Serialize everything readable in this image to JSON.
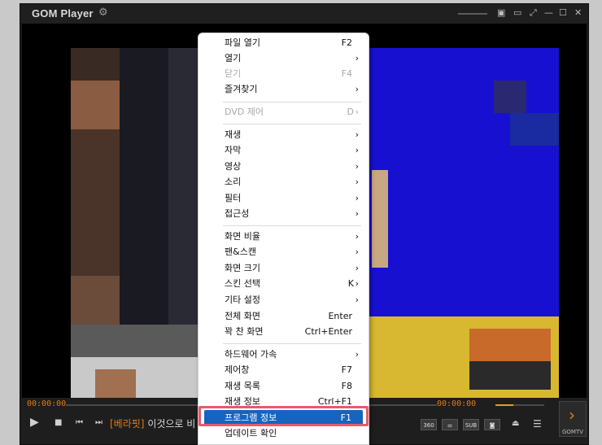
{
  "app": {
    "title": "GOM Player"
  },
  "player": {
    "time_elapsed": "00:00:00",
    "time_total": "00:00:00",
    "ticker_tag": "[베라핏]",
    "ticker_text": "이것으로 비",
    "buttons": {
      "sub": "SUB",
      "gomtv": "GOMTV"
    }
  },
  "menu": {
    "items": [
      {
        "label": "파일 열기",
        "shortcut": "F2",
        "arrow": "",
        "disabled": false
      },
      {
        "label": "열기",
        "shortcut": "",
        "arrow": "›",
        "disabled": false
      },
      {
        "label": "닫기",
        "shortcut": "F4",
        "arrow": "",
        "disabled": true
      },
      {
        "label": "즐겨찾기",
        "shortcut": "",
        "arrow": "›",
        "disabled": false
      },
      {
        "label": "DVD 제어",
        "shortcut": "D",
        "arrow": "›",
        "disabled": true
      },
      {
        "label": "재생",
        "shortcut": "",
        "arrow": "›",
        "disabled": false
      },
      {
        "label": "자막",
        "shortcut": "",
        "arrow": "›",
        "disabled": false
      },
      {
        "label": "영상",
        "shortcut": "",
        "arrow": "›",
        "disabled": false
      },
      {
        "label": "소리",
        "shortcut": "",
        "arrow": "›",
        "disabled": false
      },
      {
        "label": "필터",
        "shortcut": "",
        "arrow": "›",
        "disabled": false
      },
      {
        "label": "접근성",
        "shortcut": "",
        "arrow": "›",
        "disabled": false
      },
      {
        "label": "화면 비율",
        "shortcut": "",
        "arrow": "›",
        "disabled": false
      },
      {
        "label": "팬&스캔",
        "shortcut": "",
        "arrow": "›",
        "disabled": false
      },
      {
        "label": "화면 크기",
        "shortcut": "",
        "arrow": "›",
        "disabled": false
      },
      {
        "label": "스킨 선택",
        "shortcut": "K",
        "arrow": "›",
        "disabled": false
      },
      {
        "label": "기타 설정",
        "shortcut": "",
        "arrow": "›",
        "disabled": false
      },
      {
        "label": "전체 화면",
        "shortcut": "Enter",
        "arrow": "",
        "disabled": false
      },
      {
        "label": "꽉 찬 화면",
        "shortcut": "Ctrl+Enter",
        "arrow": "",
        "disabled": false
      },
      {
        "label": "하드웨어 가속",
        "shortcut": "",
        "arrow": "›",
        "disabled": false
      },
      {
        "label": "제어창",
        "shortcut": "F7",
        "arrow": "",
        "disabled": false
      },
      {
        "label": "재생 목록",
        "shortcut": "F8",
        "arrow": "",
        "disabled": false
      },
      {
        "label": "재생 정보",
        "shortcut": "Ctrl+F1",
        "arrow": "",
        "disabled": false
      },
      {
        "label": "프로그램 정보",
        "shortcut": "F1",
        "arrow": "",
        "disabled": false
      },
      {
        "label": "업데이트 확인",
        "shortcut": "",
        "arrow": "",
        "disabled": false
      }
    ]
  }
}
